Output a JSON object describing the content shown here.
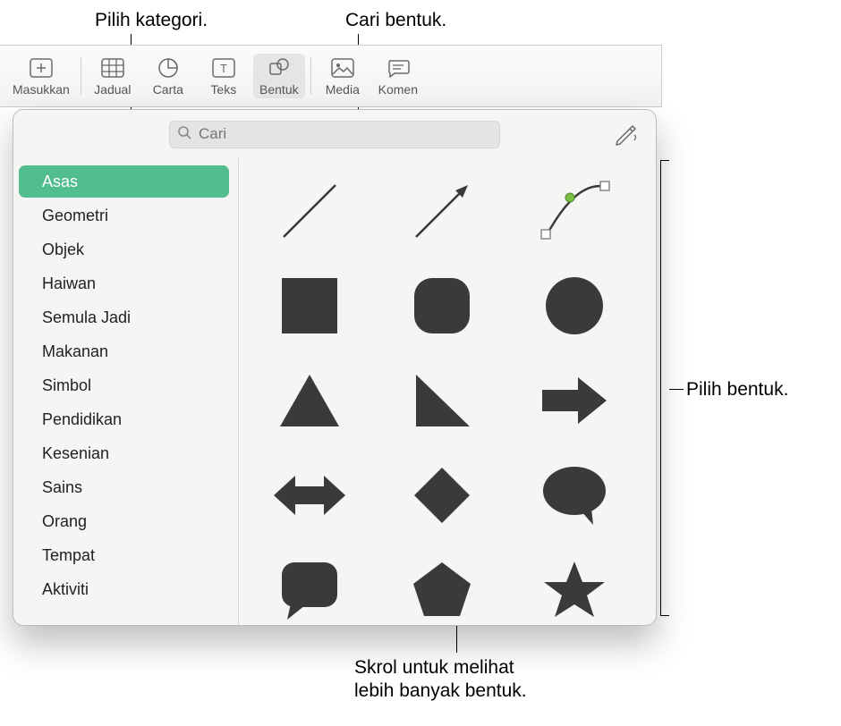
{
  "callouts": {
    "category": "Pilih kategori.",
    "search": "Cari bentuk.",
    "pick": "Pilih bentuk.",
    "scroll_line1": "Skrol untuk melihat",
    "scroll_line2": "lebih banyak bentuk."
  },
  "toolbar": {
    "insert": "Masukkan",
    "table": "Jadual",
    "chart": "Carta",
    "text": "Teks",
    "shape": "Bentuk",
    "media": "Media",
    "comment": "Komen"
  },
  "search": {
    "placeholder": "Cari"
  },
  "categories": [
    "Asas",
    "Geometri",
    "Objek",
    "Haiwan",
    "Semula Jadi",
    "Makanan",
    "Simbol",
    "Pendidikan",
    "Kesenian",
    "Sains",
    "Orang",
    "Tempat",
    "Aktiviti"
  ],
  "selected_category_index": 0,
  "shapes": [
    [
      "line",
      "arrow-line",
      "curve-tool"
    ],
    [
      "square",
      "rounded-square",
      "circle"
    ],
    [
      "triangle",
      "right-triangle",
      "arrow-right"
    ],
    [
      "double-arrow",
      "diamond",
      "speech-bubble-oval"
    ],
    [
      "speech-bubble-square",
      "pentagon",
      "star"
    ]
  ],
  "colors": {
    "accent": "#52bd8e",
    "shape_fill": "#3a3a3a",
    "curve_handle": "#7bc043"
  }
}
